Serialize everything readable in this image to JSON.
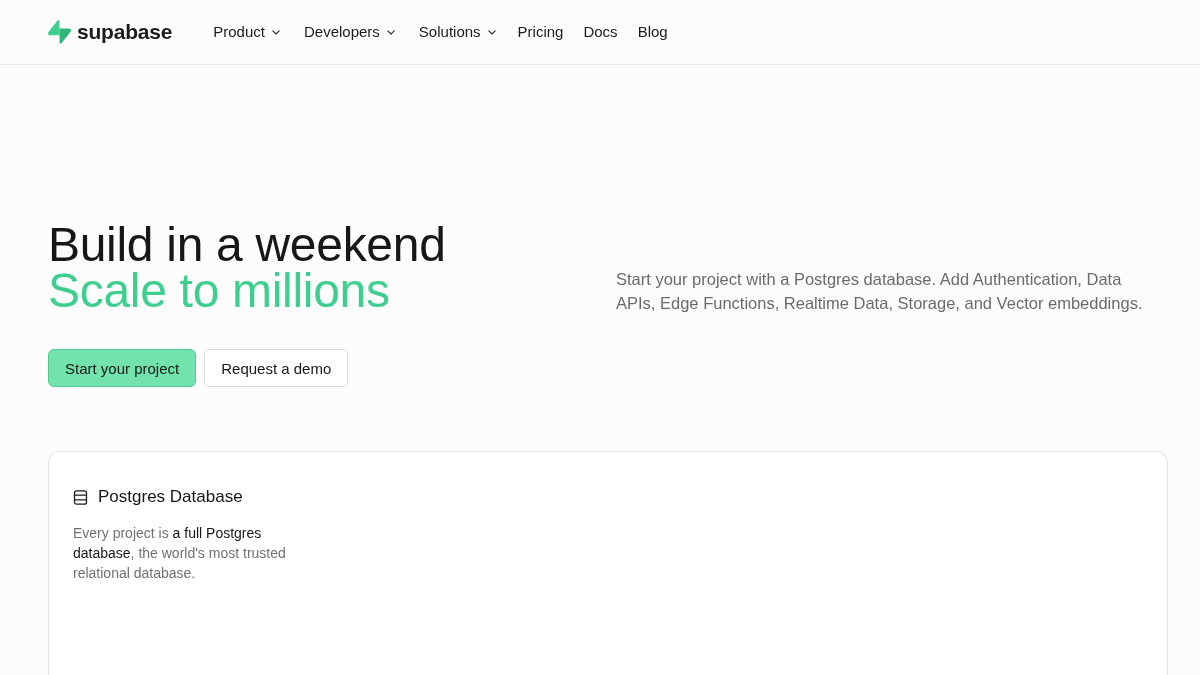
{
  "header": {
    "logo": "supabase",
    "nav": [
      {
        "label": "Product",
        "dropdown": true
      },
      {
        "label": "Developers",
        "dropdown": true
      },
      {
        "label": "Solutions",
        "dropdown": true
      },
      {
        "label": "Pricing",
        "dropdown": false
      },
      {
        "label": "Docs",
        "dropdown": false
      },
      {
        "label": "Blog",
        "dropdown": false
      }
    ]
  },
  "hero": {
    "title": "Build in a weekend",
    "subtitle": "Scale to millions",
    "buttons": [
      {
        "label": "Start your project",
        "kind": "primary"
      },
      {
        "label": "Request a demo",
        "kind": "secondary"
      }
    ],
    "description": "Start your project with a Postgres database. Add Authentication, Data APIs, Edge Functions, Realtime Data, Storage, and Vector embeddings."
  },
  "features": [
    {
      "title": "Postgres Database",
      "description": "Every project is **a full Postgres database**, the world's most trusted relational database."
    }
  ]
}
